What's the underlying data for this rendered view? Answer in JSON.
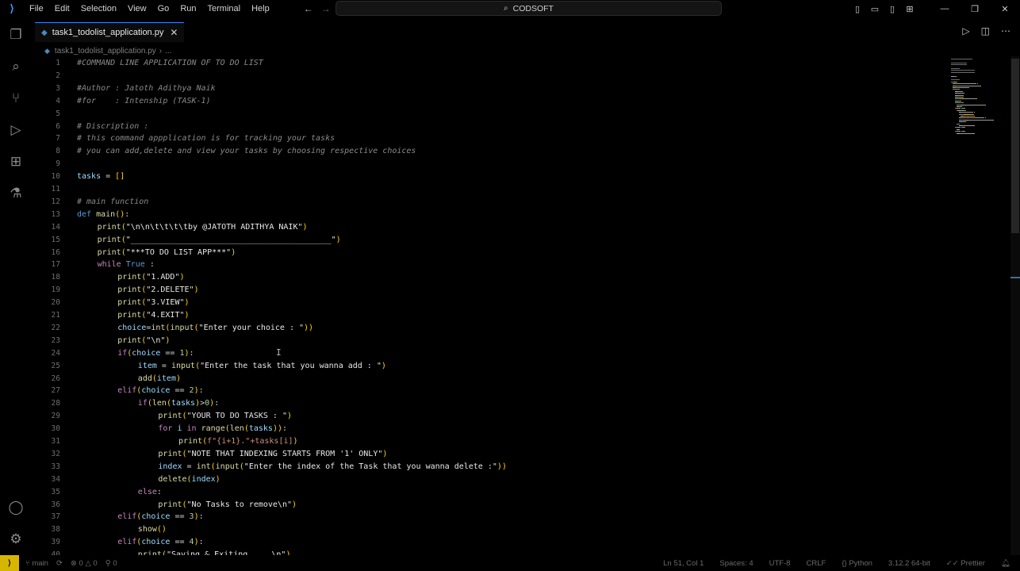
{
  "menu": [
    "File",
    "Edit",
    "Selection",
    "View",
    "Go",
    "Run",
    "Terminal",
    "Help"
  ],
  "search": {
    "label": "CODSOFT"
  },
  "tab": {
    "label": "task1_todolist_application.py"
  },
  "breadcrumb": {
    "file": "task1_todolist_application.py",
    "more": "..."
  },
  "status": {
    "branch": "main",
    "errors": "0",
    "warnings": "0",
    "info": "0",
    "position": "Ln 51, Col 1",
    "spaces": "Spaces: 4",
    "encoding": "UTF-8",
    "eol": "CRLF",
    "language": "Python",
    "interpreter": "3.12.2 64-bit",
    "formatter": "Prettier"
  },
  "code_lines": [
    {
      "n": "1",
      "indent": 0,
      "t": [
        [
          "cm",
          "#COMMAND LINE APPLICATION OF TO DO LIST"
        ]
      ]
    },
    {
      "n": "2",
      "indent": 0,
      "t": []
    },
    {
      "n": "3",
      "indent": 0,
      "t": [
        [
          "cm",
          "#Author : Jatoth Adithya Naik"
        ]
      ]
    },
    {
      "n": "4",
      "indent": 0,
      "t": [
        [
          "cm",
          "#for    : Intenship (TASK-1)"
        ]
      ]
    },
    {
      "n": "5",
      "indent": 0,
      "t": []
    },
    {
      "n": "6",
      "indent": 0,
      "t": [
        [
          "cm",
          "# Discription :"
        ]
      ]
    },
    {
      "n": "7",
      "indent": 0,
      "t": [
        [
          "cm",
          "# this command appplication is for tracking your tasks"
        ]
      ]
    },
    {
      "n": "8",
      "indent": 0,
      "t": [
        [
          "cm",
          "# you can add,delete and view your tasks by choosing respective choices"
        ]
      ]
    },
    {
      "n": "9",
      "indent": 0,
      "t": []
    },
    {
      "n": "10",
      "indent": 0,
      "t": [
        [
          "var",
          "tasks"
        ],
        [
          "txt",
          " = "
        ],
        [
          "p",
          "[]"
        ]
      ]
    },
    {
      "n": "11",
      "indent": 0,
      "t": []
    },
    {
      "n": "12",
      "indent": 0,
      "t": [
        [
          "cm",
          "# main function"
        ]
      ]
    },
    {
      "n": "13",
      "indent": 0,
      "t": [
        [
          "def",
          "def "
        ],
        [
          "fn",
          "main"
        ],
        [
          "p",
          "()"
        ],
        [
          "txt",
          ":"
        ]
      ]
    },
    {
      "n": "14",
      "indent": 1,
      "t": [
        [
          "fn",
          "print"
        ],
        [
          "p",
          "("
        ],
        [
          "hl",
          "\"\\n\\n\\t\\t\\t\\tby @JATOTH ADITHYA NAIK\""
        ],
        [
          "p",
          ")"
        ]
      ]
    },
    {
      "n": "15",
      "indent": 1,
      "t": [
        [
          "fn",
          "print"
        ],
        [
          "p",
          "("
        ],
        [
          "hl",
          "\"__________________________________________\""
        ],
        [
          "p",
          ")"
        ]
      ]
    },
    {
      "n": "16",
      "indent": 1,
      "t": [
        [
          "fn",
          "print"
        ],
        [
          "p",
          "("
        ],
        [
          "hl",
          "\"***TO DO LIST APP***\""
        ],
        [
          "p",
          ")"
        ]
      ]
    },
    {
      "n": "17",
      "indent": 1,
      "t": [
        [
          "kw",
          "while "
        ],
        [
          "def",
          "True"
        ],
        [
          "txt",
          " :"
        ]
      ]
    },
    {
      "n": "18",
      "indent": 2,
      "t": [
        [
          "fn",
          "print"
        ],
        [
          "p",
          "("
        ],
        [
          "hl",
          "\"1.ADD\""
        ],
        [
          "p",
          ")"
        ]
      ]
    },
    {
      "n": "19",
      "indent": 2,
      "t": [
        [
          "fn",
          "print"
        ],
        [
          "p",
          "("
        ],
        [
          "hl",
          "\"2.DELETE\""
        ],
        [
          "p",
          ")"
        ]
      ]
    },
    {
      "n": "20",
      "indent": 2,
      "t": [
        [
          "fn",
          "print"
        ],
        [
          "p",
          "("
        ],
        [
          "hl",
          "\"3.VIEW\""
        ],
        [
          "p",
          ")"
        ]
      ]
    },
    {
      "n": "21",
      "indent": 2,
      "t": [
        [
          "fn",
          "print"
        ],
        [
          "p",
          "("
        ],
        [
          "hl",
          "\"4.EXIT\""
        ],
        [
          "p",
          ")"
        ]
      ]
    },
    {
      "n": "22",
      "indent": 2,
      "t": [
        [
          "var",
          "choice"
        ],
        [
          "txt",
          "="
        ],
        [
          "fn",
          "int"
        ],
        [
          "p",
          "("
        ],
        [
          "fn",
          "input"
        ],
        [
          "p",
          "("
        ],
        [
          "hl",
          "\"Enter your choice : \""
        ],
        [
          "p",
          "))"
        ]
      ]
    },
    {
      "n": "23",
      "indent": 2,
      "t": [
        [
          "fn",
          "print"
        ],
        [
          "p",
          "("
        ],
        [
          "hl",
          "\"\\n\""
        ],
        [
          "p",
          ")"
        ]
      ]
    },
    {
      "n": "24",
      "indent": 2,
      "t": [
        [
          "kw",
          "if"
        ],
        [
          "p",
          "("
        ],
        [
          "var",
          "choice"
        ],
        [
          "txt",
          " == "
        ],
        [
          "num",
          "1"
        ],
        [
          "p",
          ")"
        ],
        [
          "txt",
          ":"
        ]
      ]
    },
    {
      "n": "25",
      "indent": 3,
      "t": [
        [
          "var",
          "item"
        ],
        [
          "txt",
          " = "
        ],
        [
          "fn",
          "input"
        ],
        [
          "p",
          "("
        ],
        [
          "hl",
          "\"Enter the task that you wanna add : \""
        ],
        [
          "p",
          ")"
        ]
      ]
    },
    {
      "n": "26",
      "indent": 3,
      "t": [
        [
          "fn",
          "add"
        ],
        [
          "p",
          "("
        ],
        [
          "var",
          "item"
        ],
        [
          "p",
          ")"
        ]
      ]
    },
    {
      "n": "27",
      "indent": 2,
      "t": [
        [
          "kw",
          "elif"
        ],
        [
          "p",
          "("
        ],
        [
          "var",
          "choice"
        ],
        [
          "txt",
          " == "
        ],
        [
          "num",
          "2"
        ],
        [
          "p",
          ")"
        ],
        [
          "txt",
          ":"
        ]
      ]
    },
    {
      "n": "28",
      "indent": 3,
      "t": [
        [
          "kw",
          "if"
        ],
        [
          "p",
          "("
        ],
        [
          "fn",
          "len"
        ],
        [
          "p",
          "("
        ],
        [
          "var",
          "tasks"
        ],
        [
          "p",
          ")"
        ],
        [
          "txt",
          ">"
        ],
        [
          "num",
          "0"
        ],
        [
          "p",
          ")"
        ],
        [
          "txt",
          ":"
        ]
      ]
    },
    {
      "n": "29",
      "indent": 4,
      "t": [
        [
          "fn",
          "print"
        ],
        [
          "p",
          "("
        ],
        [
          "hl",
          "\"YOUR TO DO TASKS : \""
        ],
        [
          "p",
          ")"
        ]
      ]
    },
    {
      "n": "30",
      "indent": 4,
      "t": [
        [
          "kw",
          "for "
        ],
        [
          "var",
          "i"
        ],
        [
          "kw",
          " in "
        ],
        [
          "fn",
          "range"
        ],
        [
          "p",
          "("
        ],
        [
          "fn",
          "len"
        ],
        [
          "p",
          "("
        ],
        [
          "var",
          "tasks"
        ],
        [
          "p",
          "))"
        ],
        [
          "txt",
          ":"
        ]
      ]
    },
    {
      "n": "31",
      "indent": 5,
      "t": [
        [
          "fn",
          "print"
        ],
        [
          "p",
          "("
        ],
        [
          "st",
          "f\"{i+1}.\"+tasks[i]"
        ],
        [
          "p",
          ")"
        ]
      ]
    },
    {
      "n": "32",
      "indent": 4,
      "t": [
        [
          "fn",
          "print"
        ],
        [
          "p",
          "("
        ],
        [
          "hl",
          "\"NOTE THAT INDEXING STARTS FROM '1' ONLY\""
        ],
        [
          "p",
          ")"
        ]
      ]
    },
    {
      "n": "33",
      "indent": 4,
      "t": [
        [
          "var",
          "index"
        ],
        [
          "txt",
          " = "
        ],
        [
          "fn",
          "int"
        ],
        [
          "p",
          "("
        ],
        [
          "fn",
          "input"
        ],
        [
          "p",
          "("
        ],
        [
          "hl",
          "\"Enter the index of the Task that you wanna delete :\""
        ],
        [
          "p",
          "))"
        ]
      ]
    },
    {
      "n": "34",
      "indent": 4,
      "t": [
        [
          "fn",
          "delete"
        ],
        [
          "p",
          "("
        ],
        [
          "var",
          "index"
        ],
        [
          "p",
          ")"
        ]
      ]
    },
    {
      "n": "35",
      "indent": 3,
      "t": [
        [
          "kw",
          "else"
        ],
        [
          "txt",
          ":"
        ]
      ]
    },
    {
      "n": "36",
      "indent": 4,
      "t": [
        [
          "fn",
          "print"
        ],
        [
          "p",
          "("
        ],
        [
          "hl",
          "\"No Tasks to remove\\n\""
        ],
        [
          "p",
          ")"
        ]
      ]
    },
    {
      "n": "37",
      "indent": 2,
      "t": [
        [
          "kw",
          "elif"
        ],
        [
          "p",
          "("
        ],
        [
          "var",
          "choice"
        ],
        [
          "txt",
          " == "
        ],
        [
          "num",
          "3"
        ],
        [
          "p",
          ")"
        ],
        [
          "txt",
          ":"
        ]
      ]
    },
    {
      "n": "38",
      "indent": 3,
      "t": [
        [
          "fn",
          "show"
        ],
        [
          "p",
          "()"
        ]
      ]
    },
    {
      "n": "39",
      "indent": 2,
      "t": [
        [
          "kw",
          "elif"
        ],
        [
          "p",
          "("
        ],
        [
          "var",
          "choice"
        ],
        [
          "txt",
          " == "
        ],
        [
          "num",
          "4"
        ],
        [
          "p",
          ")"
        ],
        [
          "txt",
          ":"
        ]
      ]
    },
    {
      "n": "40",
      "indent": 3,
      "t": [
        [
          "fn",
          "print"
        ],
        [
          "p",
          "("
        ],
        [
          "hl",
          "\"Saving & Exiting.....\\n\""
        ],
        [
          "p",
          ")"
        ]
      ]
    }
  ]
}
